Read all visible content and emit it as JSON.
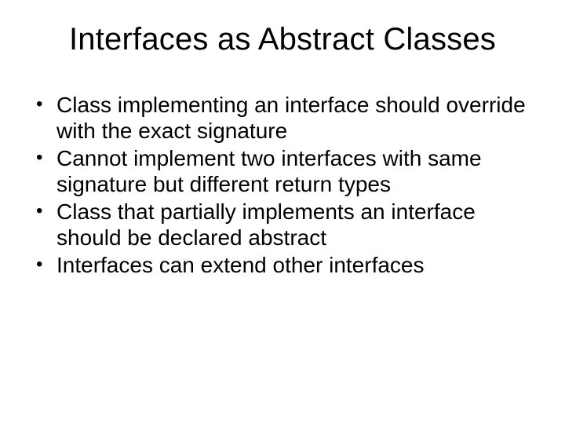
{
  "slide": {
    "title": "Interfaces as Abstract Classes",
    "bullets": [
      "Class implementing an interface should override with the exact signature",
      "Cannot implement two interfaces with same signature but different return types",
      "Class that partially implements an interface should be declared abstract",
      "Interfaces can extend other interfaces"
    ]
  }
}
